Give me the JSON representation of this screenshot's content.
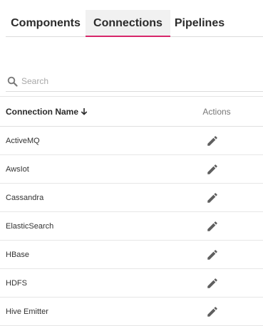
{
  "tabs": [
    {
      "label": "Components",
      "active": false
    },
    {
      "label": "Connections",
      "active": true
    },
    {
      "label": "Pipelines",
      "active": false
    }
  ],
  "accent_color": "#d7266a",
  "search": {
    "placeholder": "Search",
    "value": "",
    "icon": "search-icon"
  },
  "table": {
    "columns": {
      "name": "Connection Name",
      "name_sort": "descending",
      "actions": "Actions"
    },
    "rows": [
      {
        "name": "ActiveMQ",
        "action_icon": "edit-icon"
      },
      {
        "name": "AwsIot",
        "action_icon": "edit-icon"
      },
      {
        "name": "Cassandra",
        "action_icon": "edit-icon"
      },
      {
        "name": "ElasticSearch",
        "action_icon": "edit-icon"
      },
      {
        "name": "HBase",
        "action_icon": "edit-icon"
      },
      {
        "name": "HDFS",
        "action_icon": "edit-icon"
      },
      {
        "name": "Hive Emitter",
        "action_icon": "edit-icon"
      }
    ]
  }
}
